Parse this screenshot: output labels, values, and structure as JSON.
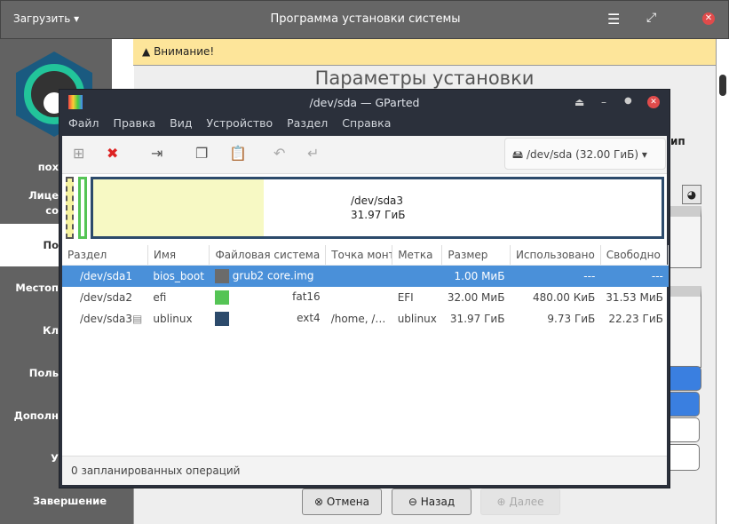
{
  "topbar": {
    "load_label": "Загрузить",
    "title": "Программа установки системы"
  },
  "sidebar": {
    "items": [
      "пох",
      "Лице",
      "со",
      "По",
      "Местоп",
      "Кл",
      "Поль",
      "Дополн",
      "У",
      "Завершение"
    ]
  },
  "main": {
    "warning": "Внимание!",
    "title": "Параметры установки",
    "type_fragment": "ип"
  },
  "gparted": {
    "title": "/dev/sda — GParted",
    "menu": [
      "Файл",
      "Правка",
      "Вид",
      "Устройство",
      "Раздел",
      "Справка"
    ],
    "device": "/dev/sda (32.00 ГиБ)",
    "graph": {
      "name": "/dev/sda3",
      "size": "31.97 ГиБ"
    },
    "columns": [
      "Раздел",
      "Имя",
      "Файловая система",
      "Точка монт",
      "Метка",
      "Размер",
      "Использовано",
      "Свободно"
    ],
    "rows": [
      {
        "part": "/dev/sda1",
        "name": "bios_boot",
        "color": "#6b6b6b",
        "fs": "grub2 core.img",
        "mount": "",
        "label": "",
        "size": "1.00 МиБ",
        "used": "---",
        "free": "---"
      },
      {
        "part": "/dev/sda2",
        "name": "efi",
        "color": "#55c455",
        "fs": "fat16",
        "mount": "",
        "label": "EFI",
        "size": "32.00 МиБ",
        "used": "480.00 КиБ",
        "free": "31.53 МиБ"
      },
      {
        "part": "/dev/sda3",
        "name": "ublinux",
        "color": "#2c4a6b",
        "fs": "ext4",
        "mount": "/home, /…",
        "label": "ublinux",
        "size": "31.97 ГиБ",
        "used": "9.73 ГиБ",
        "free": "22.23 ГиБ"
      }
    ],
    "status": "0 запланированных операций"
  },
  "buttons": {
    "cancel": "Отмена",
    "back": "Назад",
    "next": "Далее"
  }
}
